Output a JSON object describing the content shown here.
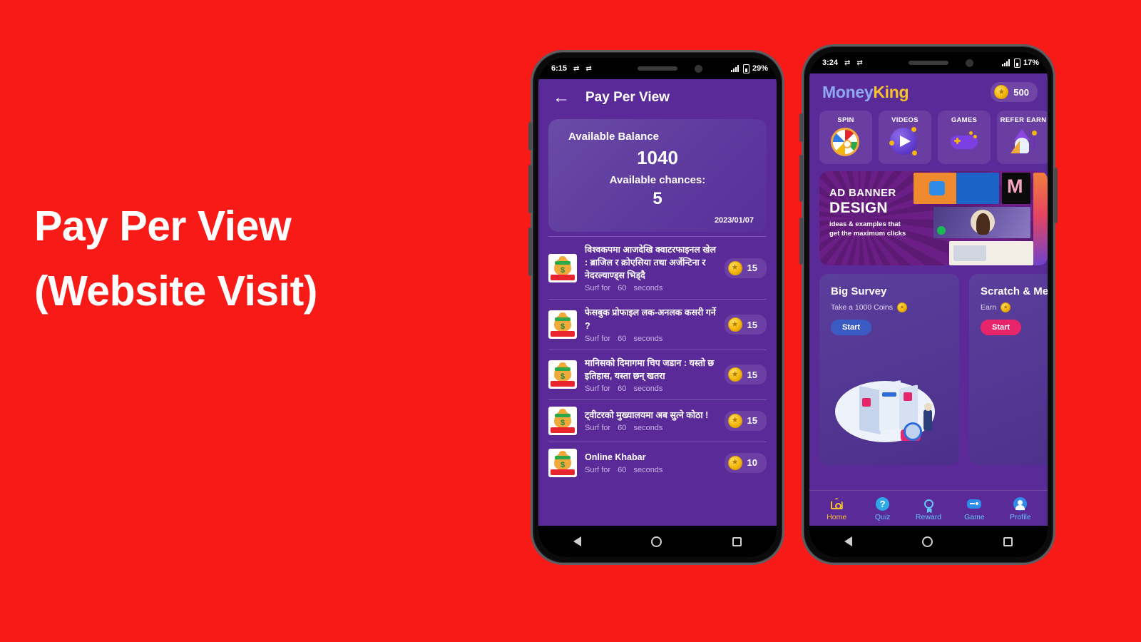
{
  "poster": {
    "background_color": "#F81A17",
    "headline_line1": "Pay Per View",
    "headline_line2": "(Website Visit)"
  },
  "phone_left": {
    "status_bar": {
      "time": "6:15",
      "icon1": "sync-icon",
      "icon2": "sync-icon",
      "signal": "signal-bars-icon",
      "battery_percent": "29%"
    },
    "header": {
      "back_icon": "back-arrow-icon",
      "title": "Pay Per View"
    },
    "balance_card": {
      "balance_label": "Available Balance",
      "balance_value": "1040",
      "chances_label": "Available chances:",
      "chances_value": "5",
      "date": "2023/01/07"
    },
    "list": [
      {
        "icon": "money-bag-icon",
        "title": "विश्वकपमा आजदेखि क्वाटरफाइनल खेल : ब्राजिल र क्रोएसिया तथा अर्जेन्टिना र नेदरल्याण्ड्स भिड्दै",
        "surf_prefix": "Surf for",
        "seconds": "60",
        "surf_suffix": "seconds",
        "reward": "15",
        "coin_icon": "gold-coin-icon"
      },
      {
        "icon": "money-bag-icon",
        "title": "फेसबुक प्रोफाइल लक-अनलक कसरी गर्ने ?",
        "surf_prefix": "Surf for",
        "seconds": "60",
        "surf_suffix": "seconds",
        "reward": "15",
        "coin_icon": "gold-coin-icon"
      },
      {
        "icon": "money-bag-icon",
        "title": "मानिसको दिमागमा चिप जडान : यस्तो छ इतिहास, यस्ता छन् खतरा",
        "surf_prefix": "Surf for",
        "seconds": "60",
        "surf_suffix": "seconds",
        "reward": "15",
        "coin_icon": "gold-coin-icon"
      },
      {
        "icon": "money-bag-icon",
        "title": "ट्वीटरको मुख्यालयमा अब सुत्ने कोठा !",
        "surf_prefix": "Surf for",
        "seconds": "60",
        "surf_suffix": "seconds",
        "reward": "15",
        "coin_icon": "gold-coin-icon"
      },
      {
        "icon": "money-bag-icon",
        "title": "Online Khabar",
        "surf_prefix": "Surf for",
        "seconds": "60",
        "surf_suffix": "seconds",
        "reward": "10",
        "coin_icon": "gold-coin-icon"
      }
    ],
    "soft_nav": {
      "back": "back-triangle-icon",
      "home": "home-circle-icon",
      "recents": "recents-square-icon"
    }
  },
  "phone_right": {
    "status_bar": {
      "time": "3:24",
      "icon1": "sync-icon",
      "icon2": "sync-icon",
      "signal": "signal-bars-icon",
      "battery_percent": "17%"
    },
    "header": {
      "logo_part1": "Money",
      "logo_part2": "King",
      "logo_color1": "#8FA8F2",
      "logo_color2": "#F6C32B",
      "coin_icon": "gold-coin-icon",
      "coin_balance": "500"
    },
    "tiles": [
      {
        "label": "SPIN",
        "icon": "spin-wheel-icon"
      },
      {
        "label": "VIDEOS",
        "icon": "video-play-icon"
      },
      {
        "label": "GAMES",
        "icon": "gamepad-icon"
      },
      {
        "label": "REFER EARN",
        "icon": "wizard-icon"
      }
    ],
    "ad_banner": {
      "line1": "AD BANNER",
      "line2": "DESIGN",
      "line3": "ideas & examples that get the maximum clicks"
    },
    "promo_cards": [
      {
        "title": "Big Survey",
        "subtitle": "Take a 1000 Coins",
        "coin_icon": "gold-coin-icon",
        "button": "Start",
        "button_color": "#3B5BC4",
        "art": "survey-illustration"
      },
      {
        "title": "Scratch & Me",
        "subtitle": "Earn",
        "coin_icon": "gold-coin-icon",
        "button": "Start",
        "button_color": "#E8246A",
        "art": "scratch-card-illustration"
      }
    ],
    "bottom_nav": [
      {
        "label": "Home",
        "icon": "home-icon",
        "active": true
      },
      {
        "label": "Quiz",
        "icon": "question-mark-icon",
        "active": false
      },
      {
        "label": "Reward",
        "icon": "medal-icon",
        "active": false
      },
      {
        "label": "Game",
        "icon": "gamepad-icon",
        "active": false
      },
      {
        "label": "Profile",
        "icon": "person-icon",
        "active": false
      }
    ],
    "soft_nav": {
      "back": "back-triangle-icon",
      "home": "home-circle-icon",
      "recents": "recents-square-icon"
    }
  }
}
